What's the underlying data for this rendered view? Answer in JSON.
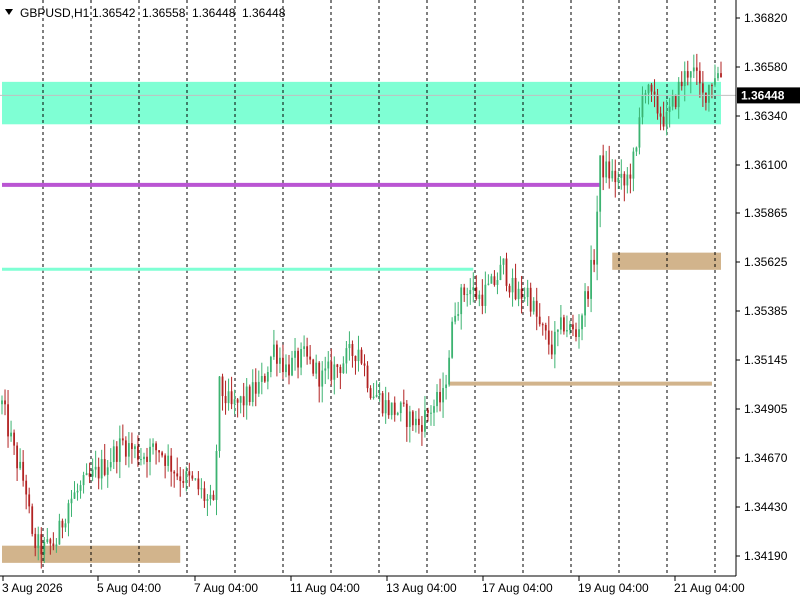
{
  "header": {
    "symbol": "GBPUSD,H1",
    "open": "1.36542",
    "high": "1.36558",
    "low": "1.36448",
    "close": "1.36448",
    "dropdown_icon": "triangle-down-icon"
  },
  "current_price_label": "1.36448",
  "colors": {
    "bull": "#3cb371",
    "bear": "#b22222",
    "grid": "#000000",
    "current_price_bg": "#000000",
    "current_price_line": "#c0c0c0"
  },
  "chart_data": {
    "type": "candlestick",
    "symbol": "GBPUSD",
    "timeframe": "H1",
    "ylim": [
      1.3407,
      1.3692
    ],
    "y_ticks": [
      "1.36820",
      "1.36580",
      "1.36340",
      "1.36100",
      "1.35865",
      "1.35625",
      "1.35385",
      "1.35145",
      "1.34905",
      "1.34670",
      "1.34430",
      "1.34190"
    ],
    "x_ticks": [
      "3 Aug 2026",
      "5 Aug 04:00",
      "7 Aug 04:00",
      "11 Aug 04:00",
      "13 Aug 04:00",
      "17 Aug 04:00",
      "19 Aug 04:00",
      "21 Aug 04:00"
    ],
    "grid": "vertical dashed",
    "current_price": 1.36448,
    "x_range": [
      0,
      238
    ],
    "zones": [
      {
        "x0": 0,
        "x1": 238,
        "y0": 1.36305,
        "y1": 1.36515,
        "color": "#7fffd4"
      },
      {
        "x0": 0,
        "x1": 59,
        "y0": 1.34135,
        "y1": 1.3422,
        "color": "#d2b48c"
      },
      {
        "x0": 202,
        "x1": 238,
        "y0": 1.35585,
        "y1": 1.3567,
        "color": "#d2b48c"
      }
    ],
    "levels": [
      {
        "x0": 0,
        "x1": 198,
        "y": 1.36005,
        "color": "#ba55d3",
        "width": 4
      },
      {
        "x0": 0,
        "x1": 156,
        "y": 1.35588,
        "color": "#7fffd4",
        "width": 3
      },
      {
        "x0": 148,
        "x1": 235,
        "y": 1.35022,
        "color": "#d2b48c",
        "width": 4
      }
    ],
    "anchors": [
      [
        0,
        1.3492
      ],
      [
        4,
        1.3468
      ],
      [
        8,
        1.345
      ],
      [
        10,
        1.3424
      ],
      [
        14,
        1.342
      ],
      [
        18,
        1.3424
      ],
      [
        22,
        1.3444
      ],
      [
        28,
        1.3453
      ],
      [
        34,
        1.3462
      ],
      [
        40,
        1.3473
      ],
      [
        46,
        1.3467
      ],
      [
        52,
        1.347
      ],
      [
        58,
        1.3458
      ],
      [
        64,
        1.3452
      ],
      [
        70,
        1.344
      ],
      [
        72,
        1.35
      ],
      [
        76,
        1.349
      ],
      [
        80,
        1.3494
      ],
      [
        86,
        1.3502
      ],
      [
        90,
        1.352
      ],
      [
        94,
        1.351
      ],
      [
        100,
        1.3515
      ],
      [
        106,
        1.3505
      ],
      [
        112,
        1.3512
      ],
      [
        118,
        1.352
      ],
      [
        122,
        1.35
      ],
      [
        128,
        1.349
      ],
      [
        132,
        1.3488
      ],
      [
        138,
        1.3482
      ],
      [
        142,
        1.349
      ],
      [
        146,
        1.3495
      ],
      [
        150,
        1.354
      ],
      [
        154,
        1.355
      ],
      [
        158,
        1.3545
      ],
      [
        162,
        1.355
      ],
      [
        166,
        1.356
      ],
      [
        170,
        1.3545
      ],
      [
        174,
        1.3548
      ],
      [
        178,
        1.353
      ],
      [
        182,
        1.352
      ],
      [
        186,
        1.3532
      ],
      [
        190,
        1.3526
      ],
      [
        194,
        1.355
      ],
      [
        196,
        1.3565
      ],
      [
        198,
        1.361
      ],
      [
        202,
        1.3605
      ],
      [
        206,
        1.36
      ],
      [
        210,
        1.3616
      ],
      [
        212,
        1.365
      ],
      [
        216,
        1.364
      ],
      [
        220,
        1.3632
      ],
      [
        224,
        1.3648
      ],
      [
        228,
        1.366
      ],
      [
        232,
        1.3644
      ],
      [
        236,
        1.3656
      ],
      [
        238,
        1.3655
      ]
    ]
  }
}
